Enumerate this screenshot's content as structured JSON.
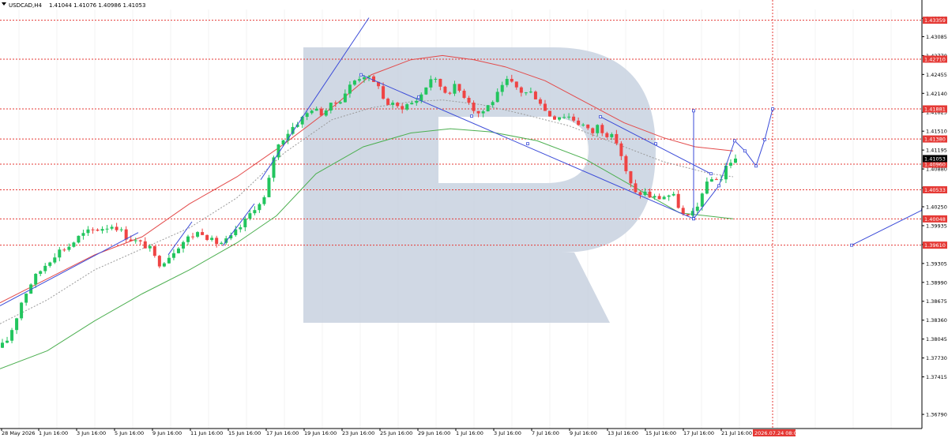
{
  "header": {
    "symbol": "USDCAD,H4",
    "quote": "1.41044 1.41076 1.40986 1.41053",
    "menu_icon": "triangle-down-icon"
  },
  "colors": {
    "bull": "#22c55e",
    "bear": "#ef4444",
    "ma_red": "#e34a4a",
    "ma_green": "#4caf50",
    "ma_dotted": "#9a9a9a",
    "trend": "#3b4bd8",
    "level": "#e53935",
    "price_tag": "#000000",
    "grid": "#e7e7e7",
    "watermark": "#c8d2e0"
  },
  "chart_data": {
    "type": "candlestick",
    "symbol": "USDCAD",
    "timeframe": "H4",
    "ylim": [
      1.3662,
      1.4363
    ],
    "y_ticks": [
      "1.43390",
      "1.43085",
      "1.42770",
      "1.42455",
      "1.42140",
      "1.41825",
      "1.41510",
      "1.41195",
      "1.40880",
      "1.40565",
      "1.40250",
      "1.39935",
      "1.39620",
      "1.39305",
      "1.38990",
      "1.38675",
      "1.38360",
      "1.38045",
      "1.37730",
      "1.37415",
      "1.36790"
    ],
    "x_labels": [
      "28 May 2026",
      "1 Jun 16:00",
      "3 Jun 16:00",
      "5 Jun 16:00",
      "9 Jun 16:00",
      "11 Jun 16:00",
      "15 Jun 16:00",
      "17 Jun 16:00",
      "19 Jun 16:00",
      "23 Jun 16:00",
      "25 Jun 16:00",
      "29 Jun 16:00",
      "1 Jul 16:00",
      "3 Jul 16:00",
      "7 Jul 16:00",
      "9 Jul 16:00",
      "13 Jul 16:00",
      "15 Jul 16:00",
      "17 Jul 16:00",
      "21 Jul 16:00"
    ],
    "forecast_time_label": "2026.07.24 08:00",
    "current_price": "1.41053",
    "levels": [
      {
        "price": 1.43359,
        "label": "1.43359"
      },
      {
        "price": 1.4271,
        "label": "1.42710"
      },
      {
        "price": 1.41881,
        "label": "1.41881"
      },
      {
        "price": 1.4138,
        "label": "1.41380"
      },
      {
        "price": 1.4096,
        "label": "1.40960"
      },
      {
        "price": 1.40533,
        "label": "1.40533"
      },
      {
        "price": 1.40048,
        "label": "1.40048"
      },
      {
        "price": 1.3961,
        "label": "1.39610"
      }
    ],
    "path_keypoints": [
      [
        0,
        1.379
      ],
      [
        8,
        1.38
      ],
      [
        18,
        1.383
      ],
      [
        28,
        1.387
      ],
      [
        40,
        1.39
      ],
      [
        55,
        1.3925
      ],
      [
        72,
        1.395
      ],
      [
        88,
        1.396
      ],
      [
        100,
        1.3975
      ],
      [
        115,
        1.3985
      ],
      [
        130,
        1.399
      ],
      [
        145,
        1.3995
      ],
      [
        160,
        1.3975
      ],
      [
        175,
        1.3965
      ],
      [
        188,
        1.3958
      ],
      [
        200,
        1.393
      ],
      [
        212,
        1.394
      ],
      [
        225,
        1.396
      ],
      [
        240,
        1.3975
      ],
      [
        255,
        1.3985
      ],
      [
        270,
        1.3965
      ],
      [
        280,
        1.3965
      ],
      [
        290,
        1.397
      ],
      [
        300,
        1.3985
      ],
      [
        310,
        1.4
      ],
      [
        322,
        1.4025
      ],
      [
        332,
        1.403
      ],
      [
        338,
        1.405
      ],
      [
        345,
        1.4105
      ],
      [
        355,
        1.4135
      ],
      [
        365,
        1.415
      ],
      [
        375,
        1.4165
      ],
      [
        385,
        1.4175
      ],
      [
        395,
        1.419
      ],
      [
        405,
        1.418
      ],
      [
        418,
        1.4192
      ],
      [
        430,
        1.4203
      ],
      [
        442,
        1.4225
      ],
      [
        452,
        1.424
      ],
      [
        462,
        1.4245
      ],
      [
        472,
        1.423
      ],
      [
        480,
        1.423
      ],
      [
        486,
        1.42
      ],
      [
        495,
        1.4195
      ],
      [
        505,
        1.419
      ],
      [
        515,
        1.4195
      ],
      [
        525,
        1.42
      ],
      [
        535,
        1.4215
      ],
      [
        545,
        1.424
      ],
      [
        555,
        1.423
      ],
      [
        565,
        1.4215
      ],
      [
        575,
        1.4225
      ],
      [
        585,
        1.4215
      ],
      [
        595,
        1.42
      ],
      [
        603,
        1.418
      ],
      [
        612,
        1.4185
      ],
      [
        622,
        1.42
      ],
      [
        632,
        1.4215
      ],
      [
        642,
        1.4235
      ],
      [
        652,
        1.4225
      ],
      [
        662,
        1.4215
      ],
      [
        672,
        1.4215
      ],
      [
        682,
        1.4205
      ],
      [
        692,
        1.418
      ],
      [
        702,
        1.4175
      ],
      [
        712,
        1.4178
      ],
      [
        722,
        1.4175
      ],
      [
        732,
        1.4165
      ],
      [
        740,
        1.416
      ],
      [
        748,
        1.4145
      ],
      [
        756,
        1.416
      ],
      [
        765,
        1.415
      ],
      [
        775,
        1.414
      ],
      [
        783,
        1.413
      ],
      [
        790,
        1.409
      ],
      [
        797,
        1.4065
      ],
      [
        805,
        1.4045
      ],
      [
        815,
        1.405
      ],
      [
        825,
        1.404
      ],
      [
        835,
        1.404
      ],
      [
        845,
        1.4045
      ],
      [
        855,
        1.404
      ],
      [
        862,
        1.4015
      ],
      [
        868,
        1.4005
      ],
      [
        875,
        1.401
      ],
      [
        882,
        1.402
      ],
      [
        888,
        1.405
      ],
      [
        894,
        1.406
      ],
      [
        900,
        1.407
      ],
      [
        906,
        1.4075
      ],
      [
        912,
        1.4068
      ],
      [
        918,
        1.409
      ],
      [
        924,
        1.41
      ],
      [
        928,
        1.4105
      ]
    ],
    "candle_count": 155,
    "ma_red": [
      [
        0,
        1.3865
      ],
      [
        60,
        1.3905
      ],
      [
        120,
        1.3945
      ],
      [
        180,
        1.3975
      ],
      [
        240,
        1.403
      ],
      [
        300,
        1.4075
      ],
      [
        360,
        1.413
      ],
      [
        420,
        1.419
      ],
      [
        470,
        1.4245
      ],
      [
        520,
        1.427
      ],
      [
        560,
        1.4277
      ],
      [
        600,
        1.427
      ],
      [
        640,
        1.4258
      ],
      [
        690,
        1.4235
      ],
      [
        740,
        1.42
      ],
      [
        790,
        1.4165
      ],
      [
        840,
        1.414
      ],
      [
        880,
        1.4125
      ],
      [
        928,
        1.4118
      ]
    ],
    "ma_green": [
      [
        0,
        1.3755
      ],
      [
        60,
        1.3785
      ],
      [
        120,
        1.3835
      ],
      [
        180,
        1.388
      ],
      [
        240,
        1.392
      ],
      [
        300,
        1.3965
      ],
      [
        350,
        1.401
      ],
      [
        400,
        1.408
      ],
      [
        460,
        1.4125
      ],
      [
        520,
        1.4148
      ],
      [
        570,
        1.4155
      ],
      [
        620,
        1.415
      ],
      [
        680,
        1.4135
      ],
      [
        740,
        1.4105
      ],
      [
        800,
        1.406
      ],
      [
        860,
        1.4015
      ],
      [
        928,
        1.4005
      ]
    ],
    "ma_dotted": [
      [
        0,
        1.383
      ],
      [
        60,
        1.387
      ],
      [
        120,
        1.392
      ],
      [
        180,
        1.3955
      ],
      [
        240,
        1.399
      ],
      [
        300,
        1.404
      ],
      [
        360,
        1.4115
      ],
      [
        420,
        1.417
      ],
      [
        470,
        1.419
      ],
      [
        520,
        1.42
      ],
      [
        560,
        1.4203
      ],
      [
        610,
        1.4195
      ],
      [
        660,
        1.418
      ],
      [
        720,
        1.416
      ],
      [
        780,
        1.413
      ],
      [
        840,
        1.41
      ],
      [
        900,
        1.408
      ],
      [
        928,
        1.4075
      ]
    ],
    "trend_lines": [
      [
        [
          0,
          1.386
        ],
        [
          175,
          1.3982
        ]
      ],
      [
        [
          213,
          1.3945
        ],
        [
          243,
          1.4
        ]
      ],
      [
        [
          282,
          1.396
        ],
        [
          322,
          1.403
        ]
      ],
      [
        [
          330,
          1.407
        ],
        [
          467,
          1.434
        ]
      ],
      [
        [
          457,
          1.4245
        ],
        [
          878,
          1.4005
        ]
      ],
      [
        [
          760,
          1.4175
        ],
        [
          900,
          1.408
        ]
      ],
      [
        [
          878,
          1.4005
        ],
        [
          878,
          1.4185
        ]
      ],
      [
        [
          1078,
          1.3961
        ],
        [
          1168,
          1.402
        ]
      ]
    ],
    "forecast_path": [
      [
        878,
        1.4005
      ],
      [
        910,
        1.406
      ],
      [
        930,
        1.4135
      ],
      [
        943,
        1.4118
      ],
      [
        957,
        1.4093
      ],
      [
        968,
        1.4137
      ],
      [
        978,
        1.4188
      ]
    ],
    "forecast_vline_x": 978,
    "channel_nodes": [
      [
        457,
        1.4245
      ],
      [
        530,
        1.4208
      ],
      [
        597,
        1.4176
      ],
      [
        668,
        1.413
      ],
      [
        760,
        1.4175
      ],
      [
        830,
        1.413
      ],
      [
        900,
        1.408
      ],
      [
        878,
        1.4005
      ]
    ]
  }
}
